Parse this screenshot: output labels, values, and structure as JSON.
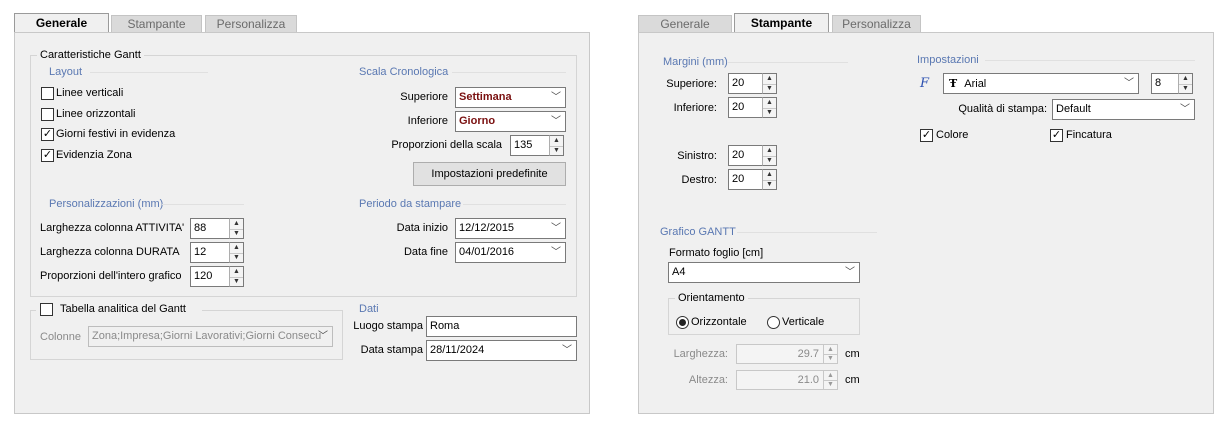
{
  "tabs": [
    "Generale",
    "Stampante",
    "Personalizza"
  ],
  "generale": {
    "gantt_group": "Caratteristiche Gantt",
    "layout": {
      "title": "Layout",
      "items": [
        {
          "label": "Linee verticali",
          "checked": false
        },
        {
          "label": "Linee orizzontali",
          "checked": false
        },
        {
          "label": "Giorni festivi in evidenza",
          "checked": true
        },
        {
          "label": "Evidenzia Zona",
          "checked": true
        }
      ]
    },
    "scala": {
      "title": "Scala Cronologica",
      "superiore_label": "Superiore",
      "superiore_value": "Settimana",
      "inferiore_label": "Inferiore",
      "inferiore_value": "Giorno",
      "proporzioni_label": "Proporzioni della scala",
      "proporzioni_value": "135",
      "default_button": "Impostazioni predefinite"
    },
    "personalizzazioni": {
      "title": "Personalizzazioni (mm)",
      "attivita_label": "Larghezza colonna ATTIVITA'",
      "attivita_value": "88",
      "durata_label": "Larghezza colonna DURATA",
      "durata_value": "12",
      "grafico_label": "Proporzioni dell'intero grafico",
      "grafico_value": "120"
    },
    "periodo": {
      "title": "Periodo da stampare",
      "inizio_label": "Data inizio",
      "inizio_value": "12/12/2015",
      "fine_label": "Data fine",
      "fine_value": "04/01/2016"
    },
    "tabella": {
      "label": "Tabella analitica del Gantt",
      "checked": false,
      "colonne_label": "Colonne",
      "colonne_value": "Zona;Impresa;Giorni Lavorativi;Giorni Consecu"
    },
    "dati": {
      "title": "Dati",
      "luogo_label": "Luogo stampa",
      "luogo_value": "Roma",
      "data_label": "Data stampa",
      "data_value": "28/11/2024"
    }
  },
  "stampante": {
    "margini": {
      "title": "Margini (mm)",
      "superiore_label": "Superiore:",
      "superiore_value": "20",
      "inferiore_label": "Inferiore:",
      "inferiore_value": "20",
      "sinistro_label": "Sinistro:",
      "sinistro_value": "20",
      "destro_label": "Destro:",
      "destro_value": "20"
    },
    "impostazioni": {
      "title": "Impostazioni",
      "font_value": "Arial",
      "font_size": "8",
      "qualita_label": "Qualità di stampa:",
      "qualita_value": "Default",
      "colore_label": "Colore",
      "colore_checked": true,
      "fincatura_label": "Fincatura",
      "fincatura_checked": true
    },
    "gantt": {
      "title": "Grafico GANTT",
      "formato_label": "Formato foglio [cm]",
      "formato_value": "A4",
      "orientamento_label": "Orientamento",
      "orizzontale_label": "Orizzontale",
      "verticale_label": "Verticale",
      "orientamento_selected": "Orizzontale",
      "larghezza_label": "Larghezza:",
      "larghezza_value": "29.7",
      "altezza_label": "Altezza:",
      "altezza_value": "21.0",
      "unit": "cm"
    }
  },
  "icons": {
    "chevron": "chevron-down-icon",
    "font": "font-icon",
    "truetype": "truetype-icon",
    "check": "check-icon"
  },
  "colors": {
    "section": "#5a78b2",
    "bold_value": "#7a1010",
    "panel": "#f0f0f0"
  }
}
